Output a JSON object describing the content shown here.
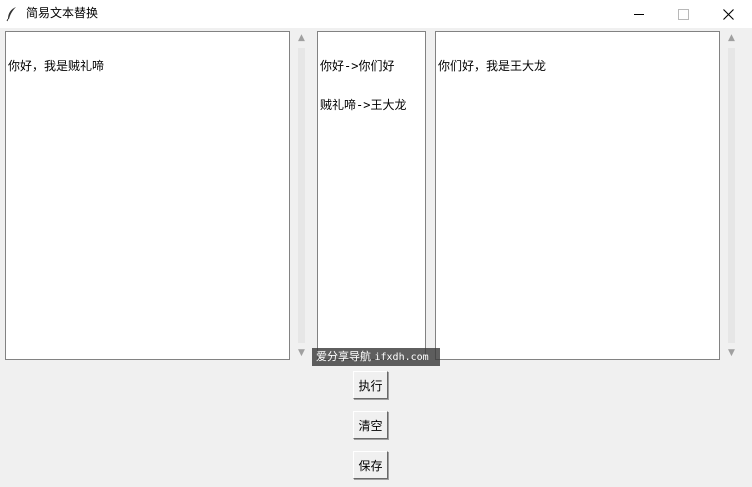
{
  "window": {
    "title": "简易文本替换",
    "icon": "feather-icon",
    "controls": {
      "minimize": "minimize-icon",
      "maximize": "maximize-icon",
      "close": "close-icon",
      "close_label": "✕"
    }
  },
  "panes": {
    "source": {
      "lines": [
        "你好，我是贼礼啼"
      ]
    },
    "rules": {
      "lines": [
        "你好->你们好",
        "贼礼啼->王大龙"
      ]
    },
    "result": {
      "lines": [
        "你们好，我是王大龙"
      ]
    }
  },
  "scrollbar": {
    "up_arrow": "▲",
    "down_arrow": "▼"
  },
  "watermark": {
    "text_cn": "爱分享导航",
    "text_en": "ifxdh.com"
  },
  "buttons": {
    "execute": "执行",
    "clear": "清空",
    "save": "保存"
  }
}
